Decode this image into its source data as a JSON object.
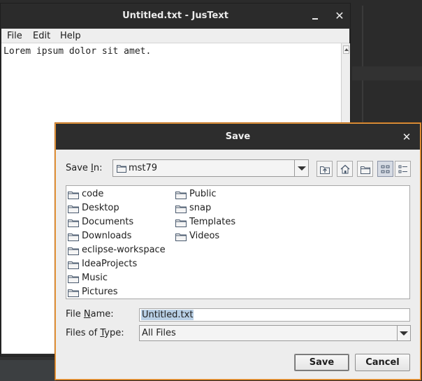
{
  "editor_window": {
    "title": "Untitled.txt - JusText",
    "menu": [
      "File",
      "Edit",
      "Help"
    ],
    "content": "Lorem ipsum dolor sit amet."
  },
  "dialog": {
    "title": "Save",
    "save_in_label_pre": "Save ",
    "save_in_label_mnemonic": "I",
    "save_in_label_post": "n:",
    "current_folder": "mst79",
    "toolbar_icons": [
      "up-one-level-icon",
      "home-icon",
      "new-folder-icon",
      "list-view-icon",
      "details-view-icon"
    ],
    "folders_col1": [
      "code",
      "Desktop",
      "Documents",
      "Downloads",
      "eclipse-workspace",
      "IdeaProjects",
      "Music",
      "Pictures"
    ],
    "folders_col2": [
      "Public",
      "snap",
      "Templates",
      "Videos"
    ],
    "file_name_label_pre": "File ",
    "file_name_label_mnemonic": "N",
    "file_name_label_post": "ame:",
    "file_name_value": "Untitled.txt",
    "file_type_label_pre": "Files of ",
    "file_type_label_mnemonic": "T",
    "file_type_label_post": "ype:",
    "file_type_value": "All Files",
    "save_button": "Save",
    "cancel_button": "Cancel"
  }
}
